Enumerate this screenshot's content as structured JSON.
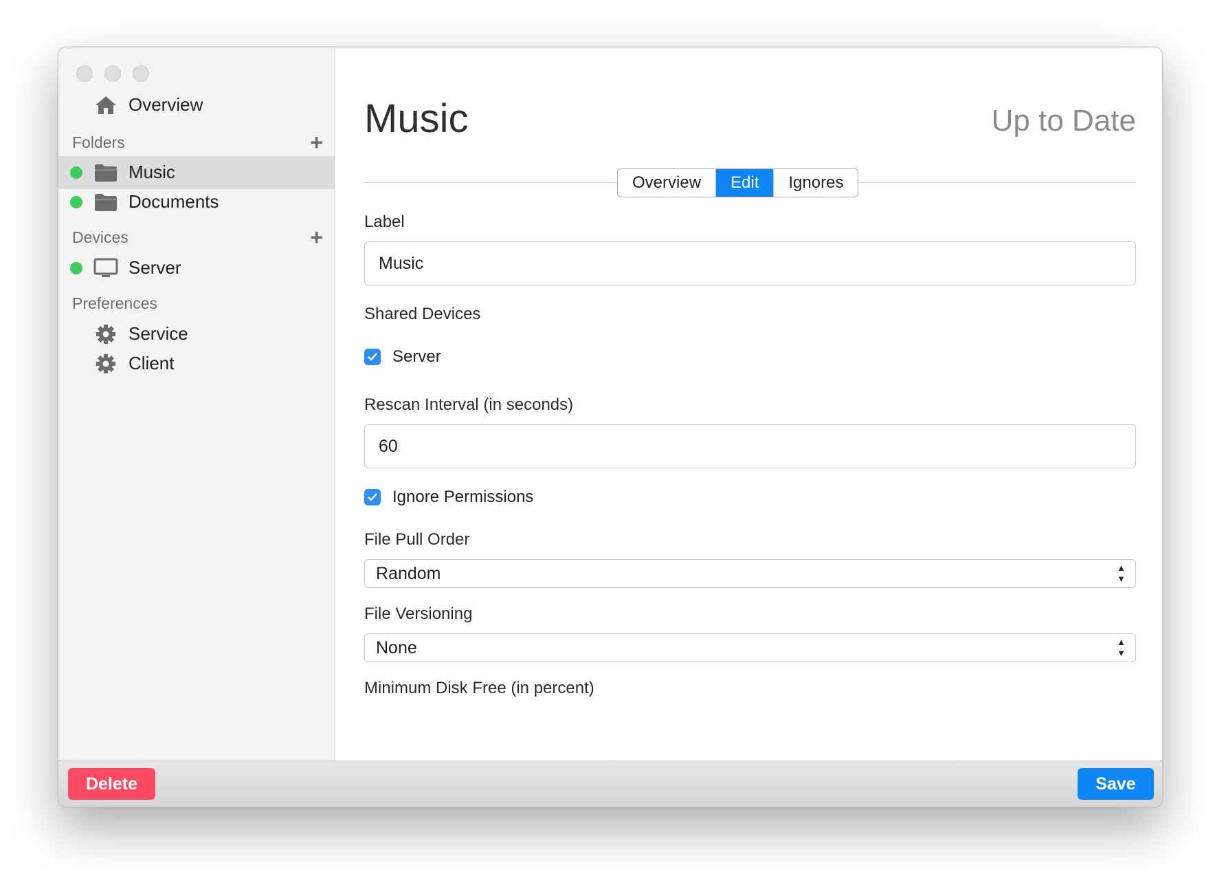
{
  "sidebar": {
    "overview_label": "Overview",
    "folders": {
      "heading": "Folders",
      "items": [
        {
          "label": "Music",
          "status": "online",
          "icon": "folder-icon"
        },
        {
          "label": "Documents",
          "status": "online",
          "icon": "folder-icon"
        }
      ]
    },
    "devices": {
      "heading": "Devices",
      "items": [
        {
          "label": "Server",
          "status": "online",
          "icon": "monitor-icon"
        }
      ]
    },
    "preferences": {
      "heading": "Preferences",
      "items": [
        {
          "label": "Service",
          "icon": "gear-icon"
        },
        {
          "label": "Client",
          "icon": "gear-icon"
        }
      ]
    }
  },
  "main": {
    "title": "Music",
    "status": "Up to Date",
    "tabs": [
      {
        "label": "Overview",
        "active": false
      },
      {
        "label": "Edit",
        "active": true
      },
      {
        "label": "Ignores",
        "active": false
      }
    ],
    "form": {
      "label_field": {
        "label": "Label",
        "value": "Music"
      },
      "shared_devices": {
        "label": "Shared Devices",
        "devices": [
          {
            "label": "Server",
            "checked": true
          }
        ]
      },
      "rescan_interval": {
        "label": "Rescan Interval (in seconds)",
        "value": "60"
      },
      "ignore_permissions": {
        "label": "Ignore Permissions",
        "checked": true
      },
      "file_pull_order": {
        "label": "File Pull Order",
        "value": "Random"
      },
      "file_versioning": {
        "label": "File Versioning",
        "value": "None"
      },
      "min_disk_free": {
        "label": "Minimum Disk Free (in percent)"
      }
    }
  },
  "footer": {
    "delete_label": "Delete",
    "save_label": "Save"
  },
  "colors": {
    "accent": "#0f86f5",
    "danger": "#fb4a62",
    "online": "#3ccc58"
  }
}
